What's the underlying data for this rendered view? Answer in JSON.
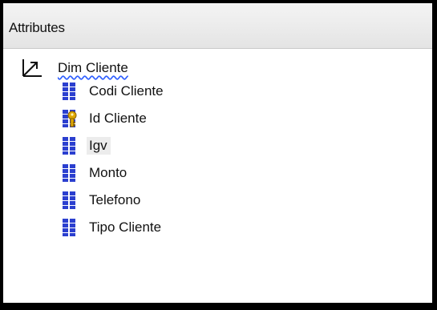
{
  "panel": {
    "title": "Attributes"
  },
  "tree": {
    "root": {
      "label": "Dim Cliente",
      "icon": "dimension-icon"
    },
    "attributes": [
      {
        "label": "Codi Cliente",
        "icon": "attribute-icon",
        "key": false,
        "selected": false
      },
      {
        "label": "Id Cliente",
        "icon": "key-attribute-icon",
        "key": true,
        "selected": false
      },
      {
        "label": "Igv",
        "icon": "attribute-icon",
        "key": false,
        "selected": true
      },
      {
        "label": "Monto",
        "icon": "attribute-icon",
        "key": false,
        "selected": false
      },
      {
        "label": "Telefono",
        "icon": "attribute-icon",
        "key": false,
        "selected": false
      },
      {
        "label": "Tipo Cliente",
        "icon": "attribute-icon",
        "key": false,
        "selected": false
      }
    ]
  },
  "colors": {
    "attribute_icon_blue": "#2b3fcf",
    "key_gold": "#e0a800",
    "squiggle_blue": "#3060ff",
    "header_bg": "#e8e8e8"
  }
}
